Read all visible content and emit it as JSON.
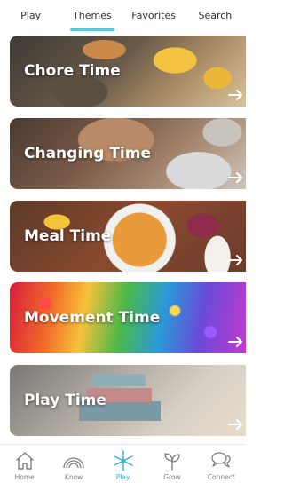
{
  "top_tabs": [
    {
      "label": "Play",
      "active": false
    },
    {
      "label": "Themes",
      "active": true
    },
    {
      "label": "Favorites",
      "active": false
    },
    {
      "label": "Search",
      "active": false
    }
  ],
  "theme_cards": [
    {
      "title": "Chore Time"
    },
    {
      "title": "Changing Time"
    },
    {
      "title": "Meal Time"
    },
    {
      "title": "Movement Time"
    },
    {
      "title": "Play Time"
    }
  ],
  "bottom_nav": [
    {
      "label": "Home",
      "icon": "house-icon",
      "active": false
    },
    {
      "label": "Know",
      "icon": "rainbow-icon",
      "active": false
    },
    {
      "label": "Play",
      "icon": "sparkle-icon",
      "active": true
    },
    {
      "label": "Grow",
      "icon": "sprout-icon",
      "active": false
    },
    {
      "label": "Connect",
      "icon": "chat-bubbles-icon",
      "active": false
    }
  ],
  "colors": {
    "accent": "#5ac8d8",
    "active_nav": "#2fb4cc",
    "text": "#2d3138",
    "muted": "#7a7f86"
  }
}
